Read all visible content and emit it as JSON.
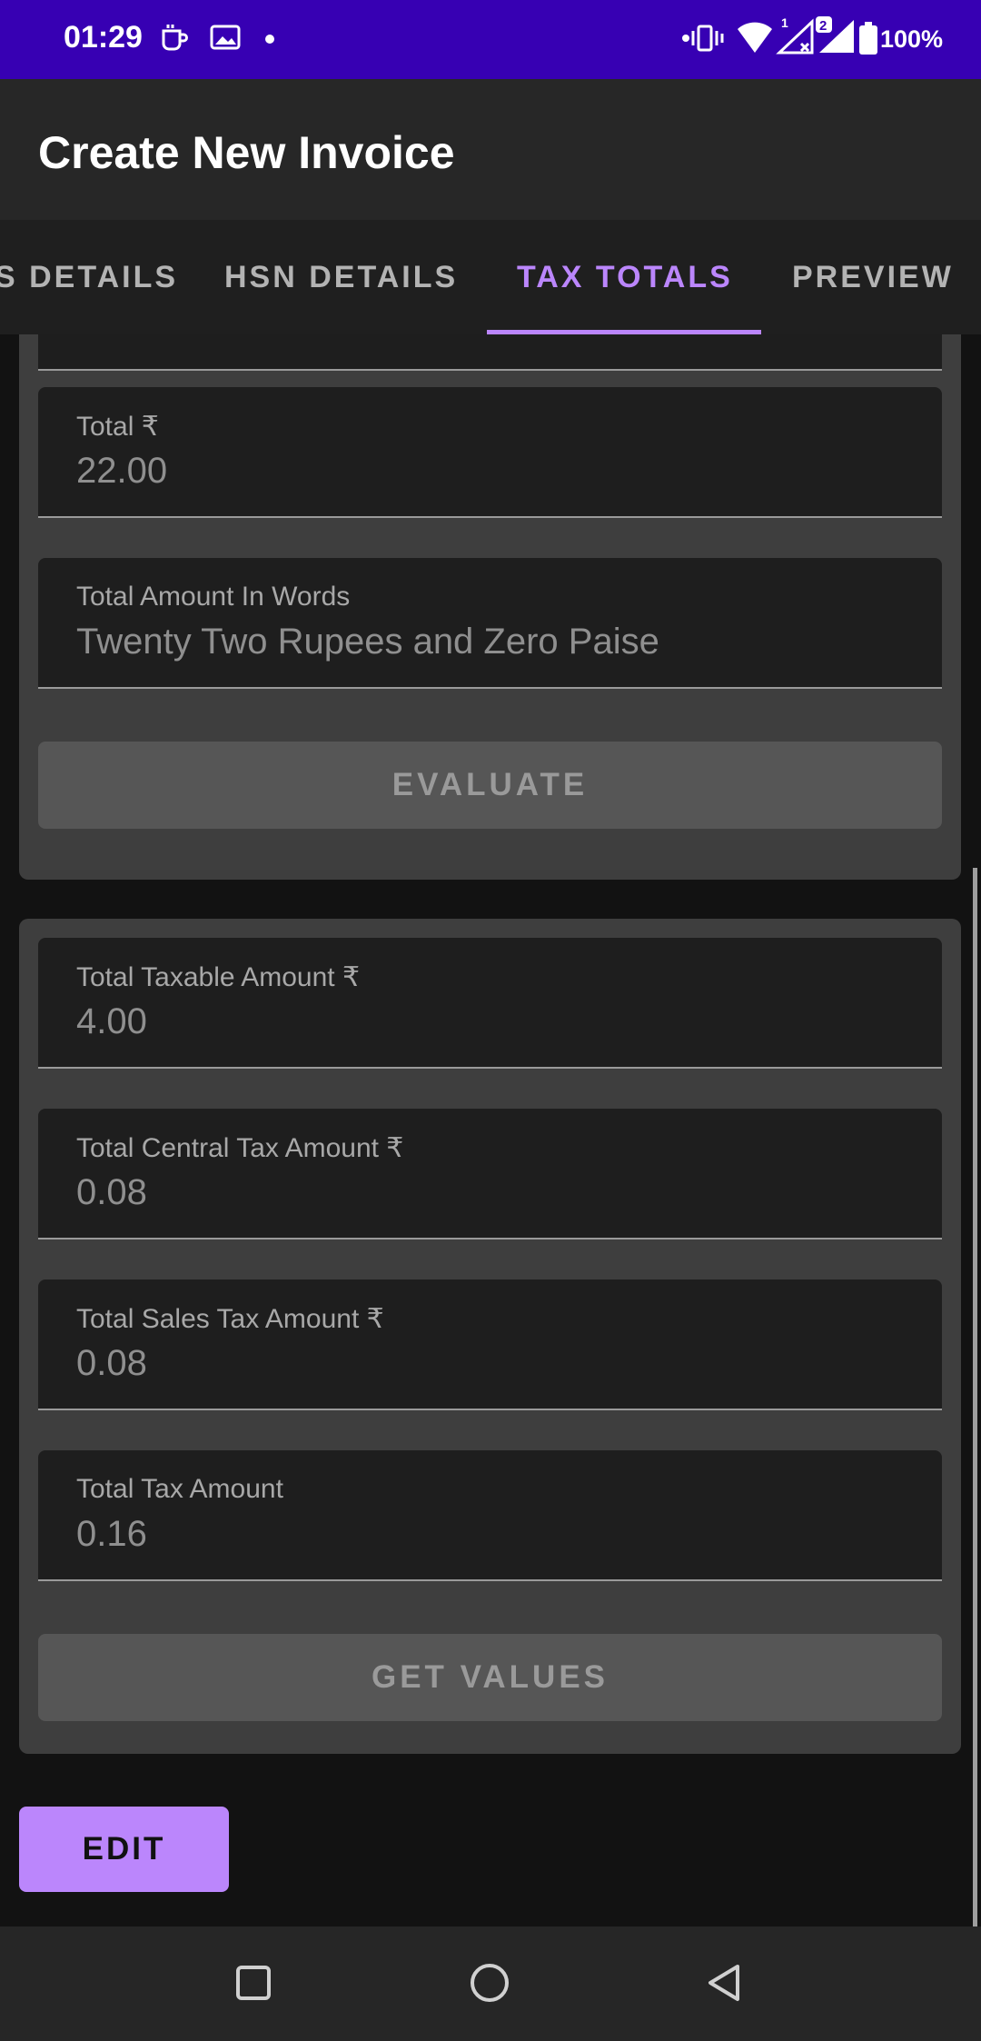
{
  "status_bar": {
    "time": "01:29",
    "battery": "100%",
    "icons": [
      "coffee-notification-icon",
      "image-notification-icon",
      "dot-icon",
      "vibrate-icon",
      "wifi-icon",
      "signal-1-icon",
      "signal-2-icon",
      "battery-icon"
    ]
  },
  "app_bar": {
    "title": "Create New Invoice"
  },
  "tabs": {
    "items": [
      {
        "label": "S DETAILS"
      },
      {
        "label": "HSN DETAILS"
      },
      {
        "label": "TAX TOTALS"
      },
      {
        "label": "PREVIEW"
      }
    ],
    "active_index": 2
  },
  "totals_card": {
    "total_label": "Total ₹",
    "total_value": "22.00",
    "words_label": "Total Amount In Words",
    "words_value": "Twenty Two Rupees and Zero Paise",
    "evaluate_label": "EVALUATE"
  },
  "tax_card": {
    "taxable_label": "Total Taxable Amount ₹",
    "taxable_value": "4.00",
    "central_label": "Total Central Tax Amount ₹",
    "central_value": "0.08",
    "sales_label": "Total Sales Tax Amount ₹",
    "sales_value": "0.08",
    "tax_label": "Total Tax Amount",
    "tax_value": "0.16",
    "get_values_label": "GET VALUES"
  },
  "edit_label": "EDIT",
  "colors": {
    "status_bar": "#3700b3",
    "accent": "#bb86fc",
    "background": "#121212"
  }
}
